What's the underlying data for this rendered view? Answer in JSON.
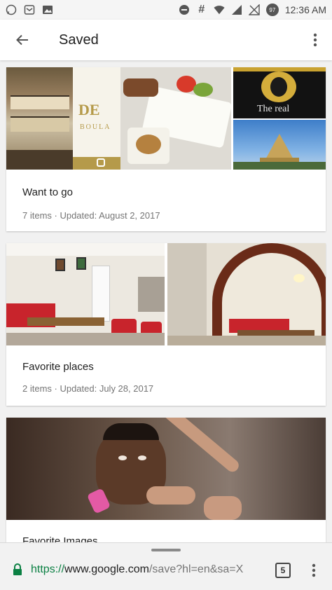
{
  "status_bar": {
    "time": "12:36 AM",
    "battery": "97",
    "network_symbol": "#",
    "icons": [
      "whatsapp-icon",
      "message-icon",
      "gallery-icon",
      "dnd-icon",
      "hash-icon",
      "wifi-icon",
      "signal-icon",
      "no-sim-icon",
      "battery-icon"
    ]
  },
  "app_bar": {
    "title": "Saved",
    "back_icon": "back-arrow-icon",
    "more_icon": "more-vert-icon"
  },
  "lists": [
    {
      "title": "Want to go",
      "subtitle": "7 items · Updated: August 2, 2017",
      "brand_text": "DE",
      "brand_sub": "BOULA",
      "sign_text": "The real"
    },
    {
      "title": "Favorite places",
      "subtitle": "2 items · Updated: July 28, 2017"
    },
    {
      "title": "Favorite Images",
      "subtitle": ""
    }
  ],
  "browser": {
    "url_scheme": "https://",
    "url_host": "www.google.com",
    "url_path": "/save?hl=en&sa=X",
    "tab_count": "5"
  },
  "colors": {
    "accent_green": "#0b8043",
    "restaurant_red": "#c8242c",
    "gold": "#b59a4a"
  }
}
